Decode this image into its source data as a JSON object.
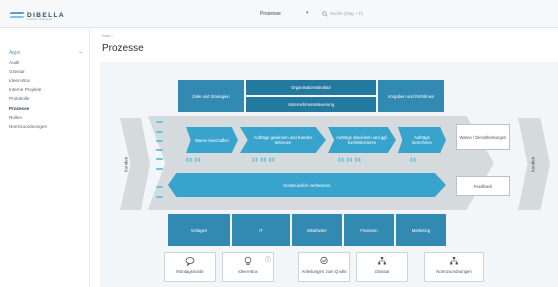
{
  "header": {
    "logo_text": "DIBELLA",
    "logo_sub": "Process Navigator",
    "process_select": "Prozesse",
    "search_placeholder": "Suche (Strg + F)"
  },
  "sidebar": {
    "heading": "Apps",
    "items": [
      {
        "label": "Audit"
      },
      {
        "label": "Glossar"
      },
      {
        "label": "Ideen-Box"
      },
      {
        "label": "Interne Projekte"
      },
      {
        "label": "Protokolle"
      },
      {
        "label": "Prozesse"
      },
      {
        "label": "Rollen"
      },
      {
        "label": "Normzuordnungen"
      }
    ],
    "active_index": 5
  },
  "main": {
    "breadcrumb": "Start  /",
    "title": "Prozesse"
  },
  "process_map": {
    "left_label": "Kunden",
    "right_label": "Kunden",
    "top": {
      "left": "Ziele und Strategien",
      "center_top": "Organisationsstruktur",
      "center_bottom": "Unternehmenssteuerung",
      "right": "Vorgaben und Richtlinien"
    },
    "core": [
      {
        "label": "Waren beschaffen"
      },
      {
        "label": "Aufträge gewinnen und Kunden betreuen"
      },
      {
        "label": "Aufträge abwickeln und ggf. konfektionieren"
      },
      {
        "label": "Aufträge berechnen"
      }
    ],
    "improve": "Kontinuierlich verbessern",
    "outputs": [
      "Waren / Dienstleistungen",
      "Feedback"
    ],
    "support": [
      "Vorlagen",
      "IT",
      "Mitarbeiter",
      "Finanzen",
      "Marketing"
    ],
    "tools": [
      {
        "label": "Montagsrunde",
        "icon": "chat-icon"
      },
      {
        "label": "Ideen-Box",
        "icon": "lightbulb-icon"
      },
      {
        "label": "Anleitungen zum Q.wiki",
        "icon": "check-badge-icon"
      },
      {
        "label": "Glossar",
        "icon": "sitemap-icon"
      },
      {
        "label": "Normzuordnungen",
        "icon": "sitemap-icon"
      }
    ],
    "info_symbol": "ⓘ"
  },
  "colors": {
    "band_blue": "#3289b1",
    "band_dark": "#23799f",
    "accent_teal": "#38a4cd",
    "light_cyan": "#6cc2e6",
    "frame_gray": "#d5dadd"
  }
}
